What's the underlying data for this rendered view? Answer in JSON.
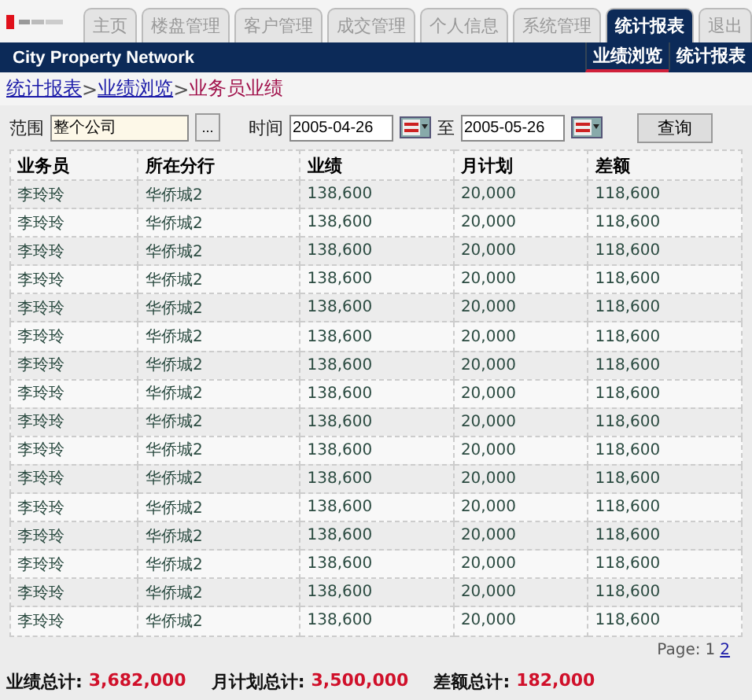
{
  "tabs": [
    {
      "label": "主页",
      "selected": false
    },
    {
      "label": "楼盘管理",
      "selected": false
    },
    {
      "label": "客户管理",
      "selected": false
    },
    {
      "label": "成交管理",
      "selected": false
    },
    {
      "label": "个人信息",
      "selected": false
    },
    {
      "label": "系统管理",
      "selected": false
    },
    {
      "label": "统计报表",
      "selected": true
    },
    {
      "label": "退出",
      "selected": false
    }
  ],
  "brand": "City Property Network",
  "subnav": [
    {
      "label": "业绩浏览",
      "selected": true
    },
    {
      "label": "统计报表",
      "selected": false
    }
  ],
  "breadcrumb": {
    "links": [
      "统计报表",
      "业绩浏览"
    ],
    "separator": ">",
    "current": "业务员业绩"
  },
  "filter": {
    "scope_label": "范围",
    "scope_value": "整个公司",
    "browse": "...",
    "time_label": "时间",
    "from": "2005-04-26",
    "to_label": "至",
    "to": "2005-05-26",
    "query": "查询"
  },
  "table": {
    "columns": [
      "业务员",
      "所在分行",
      "业绩",
      "月计划",
      "差额"
    ],
    "rows": [
      [
        "李玲玲",
        "华侨城2",
        "138,600",
        "20,000",
        "118,600"
      ],
      [
        "李玲玲",
        "华侨城2",
        "138,600",
        "20,000",
        "118,600"
      ],
      [
        "李玲玲",
        "华侨城2",
        "138,600",
        "20,000",
        "118,600"
      ],
      [
        "李玲玲",
        "华侨城2",
        "138,600",
        "20,000",
        "118,600"
      ],
      [
        "李玲玲",
        "华侨城2",
        "138,600",
        "20,000",
        "118,600"
      ],
      [
        "李玲玲",
        "华侨城2",
        "138,600",
        "20,000",
        "118,600"
      ],
      [
        "李玲玲",
        "华侨城2",
        "138,600",
        "20,000",
        "118,600"
      ],
      [
        "李玲玲",
        "华侨城2",
        "138,600",
        "20,000",
        "118,600"
      ],
      [
        "李玲玲",
        "华侨城2",
        "138,600",
        "20,000",
        "118,600"
      ],
      [
        "李玲玲",
        "华侨城2",
        "138,600",
        "20,000",
        "118,600"
      ],
      [
        "李玲玲",
        "华侨城2",
        "138,600",
        "20,000",
        "118,600"
      ],
      [
        "李玲玲",
        "华侨城2",
        "138,600",
        "20,000",
        "118,600"
      ],
      [
        "李玲玲",
        "华侨城2",
        "138,600",
        "20,000",
        "118,600"
      ],
      [
        "李玲玲",
        "华侨城2",
        "138,600",
        "20,000",
        "118,600"
      ],
      [
        "李玲玲",
        "华侨城2",
        "138,600",
        "20,000",
        "118,600"
      ],
      [
        "李玲玲",
        "华侨城2",
        "138,600",
        "20,000",
        "118,600"
      ]
    ]
  },
  "pager": {
    "label": "Page:",
    "pages": [
      {
        "label": "1",
        "selected": true
      },
      {
        "label": "2",
        "selected": false
      }
    ]
  },
  "totals": [
    {
      "label": "业绩总计:",
      "value": "3,682,000"
    },
    {
      "label": "月计划总计:",
      "value": "3,500,000"
    },
    {
      "label": "差额总计:",
      "value": "182,000"
    }
  ]
}
